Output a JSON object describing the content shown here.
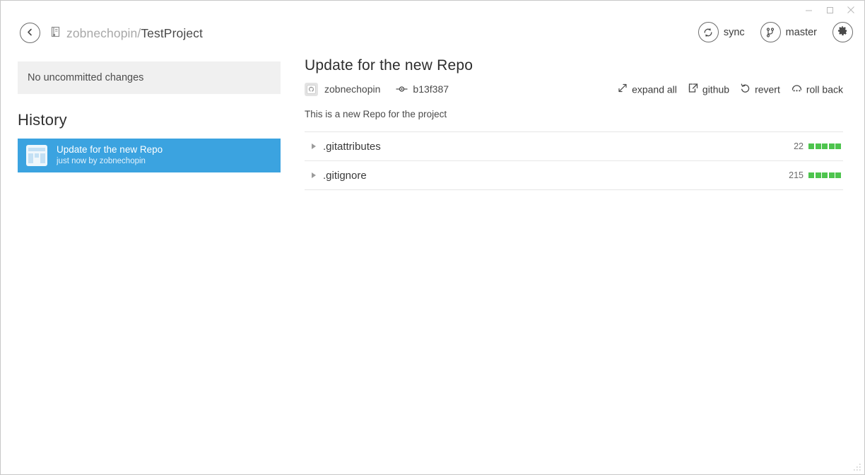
{
  "window": {
    "minimize_label": "Minimize",
    "maximize_label": "Maximize",
    "close_label": "Close"
  },
  "header": {
    "back_label": "Back",
    "repo_owner": "zobnechopin/",
    "repo_project": "TestProject",
    "sync_label": "sync",
    "branch_label": "master",
    "settings_label": "Settings"
  },
  "sidebar": {
    "uncommitted_text": "No uncommitted changes",
    "history_heading": "History",
    "commits": [
      {
        "summary": "Update for the new Repo",
        "subtitle": "just now by zobnechopin"
      }
    ]
  },
  "main": {
    "commit_title": "Update for the new Repo",
    "author": "zobnechopin",
    "sha": "b13f387",
    "description": "This is a new Repo for the project",
    "toolbar": [
      {
        "label": "expand all",
        "icon": "expand-icon"
      },
      {
        "label": "github",
        "icon": "external-link-icon"
      },
      {
        "label": "revert",
        "icon": "revert-icon"
      },
      {
        "label": "roll back",
        "icon": "roll-back-icon"
      }
    ],
    "files": [
      {
        "name": ".gitattributes",
        "count": "22",
        "blocks": 5
      },
      {
        "name": ".gitignore",
        "count": "215",
        "blocks": 5
      }
    ]
  },
  "colors": {
    "accent_blue": "#3ba3e0",
    "diff_green": "#4dc44d",
    "panel_gray": "#f0f0f0"
  }
}
